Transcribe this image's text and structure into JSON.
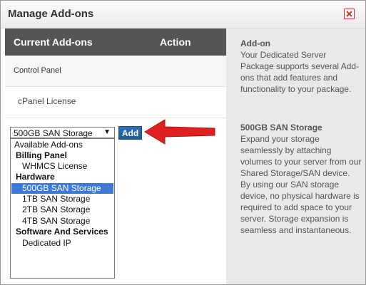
{
  "dialog": {
    "title": "Manage Add-ons"
  },
  "table": {
    "col_addons": "Current Add-ons",
    "col_action": "Action",
    "rows": [
      {
        "label": "Control Panel"
      },
      {
        "label": "cPanel License"
      }
    ]
  },
  "add_form": {
    "selected_value": "500GB SAN Storage",
    "add_label": "Add",
    "options": [
      {
        "label": "Available Add-ons",
        "kind": "top"
      },
      {
        "label": "Billing Panel",
        "kind": "group"
      },
      {
        "label": "WHMCS License",
        "kind": "sub"
      },
      {
        "label": "Hardware",
        "kind": "group"
      },
      {
        "label": "500GB SAN Storage",
        "kind": "sub",
        "selected": true
      },
      {
        "label": "1TB SAN Storage",
        "kind": "sub"
      },
      {
        "label": "2TB SAN Storage",
        "kind": "sub"
      },
      {
        "label": "4TB SAN Storage",
        "kind": "sub"
      },
      {
        "label": "Software And Services",
        "kind": "group"
      },
      {
        "label": "Dedicated IP",
        "kind": "sub"
      }
    ]
  },
  "info": {
    "addon_heading": "Add-on",
    "addon_text": "Your Dedicated Server Package supports several Add-ons that add features and functionality to your package.",
    "storage_heading": "500GB SAN Storage",
    "storage_text": "Expand your storage seamlessly by attaching volumes to your server from our Shared Storage/SAN device. By using our SAN storage device, no physical hardware is required to add space to your server. Storage expansion is seamless and instantaneous."
  },
  "icons": {
    "close": "close-icon",
    "dropdown": "chevron-down-icon",
    "annotation": "red-arrow-icon"
  },
  "colors": {
    "header_bg": "#555555",
    "accent_blue": "#1f5a96",
    "selection_blue": "#3d7ad6",
    "annotation_red": "#e02020",
    "info_panel_bg": "#e9e9e9"
  }
}
